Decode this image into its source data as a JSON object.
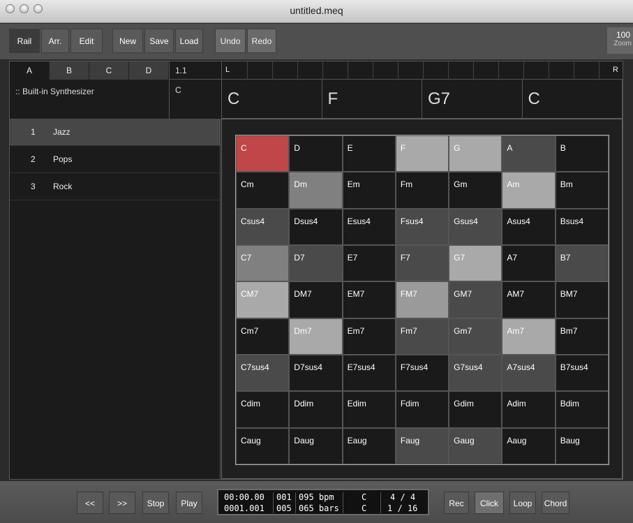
{
  "window": {
    "title": "untitled.meq"
  },
  "toolbar": {
    "rail": "Rail",
    "arr": "Arr.",
    "edit": "Edit",
    "new": "New",
    "save": "Save",
    "load": "Load",
    "undo": "Undo",
    "redo": "Redo",
    "zoom_value": "100",
    "zoom_label": "Zoom"
  },
  "tabs": [
    "A",
    "B",
    "C",
    "D"
  ],
  "synth": ":: Built-in Synthesizer",
  "position": {
    "pos": "1.1",
    "chord": "C"
  },
  "ruler": {
    "left": "L",
    "right": "R"
  },
  "timeline_chords": [
    "C",
    "F",
    "G7",
    "C"
  ],
  "styles": [
    {
      "num": "1",
      "name": "Jazz"
    },
    {
      "num": "2",
      "name": "Pops"
    },
    {
      "num": "3",
      "name": "Rock"
    }
  ],
  "grid": [
    [
      "C",
      "D",
      "E",
      "F",
      "G",
      "A",
      "B"
    ],
    [
      "Cm",
      "Dm",
      "Em",
      "Fm",
      "Gm",
      "Am",
      "Bm"
    ],
    [
      "Csus4",
      "Dsus4",
      "Esus4",
      "Fsus4",
      "Gsus4",
      "Asus4",
      "Bsus4"
    ],
    [
      "C7",
      "D7",
      "E7",
      "F7",
      "G7",
      "A7",
      "B7"
    ],
    [
      "CM7",
      "DM7",
      "EM7",
      "FM7",
      "GM7",
      "AM7",
      "BM7"
    ],
    [
      "Cm7",
      "Dm7",
      "Em7",
      "Fm7",
      "Gm7",
      "Am7",
      "Bm7"
    ],
    [
      "C7sus4",
      "D7sus4",
      "E7sus4",
      "F7sus4",
      "G7sus4",
      "A7sus4",
      "B7sus4"
    ],
    [
      "Cdim",
      "Ddim",
      "Edim",
      "Fdim",
      "Gdim",
      "Adim",
      "Bdim"
    ],
    [
      "Caug",
      "Daug",
      "Eaug",
      "Faug",
      "Gaug",
      "Aaug",
      "Baug"
    ]
  ],
  "transport": {
    "rew": "<<",
    "fwd": ">>",
    "stop": "Stop",
    "play": "Play",
    "rec": "Rec",
    "click": "Click",
    "loop": "Loop",
    "chord": "Chord",
    "time": "00:00.00",
    "bar_pos": "0001.001",
    "n1": "001",
    "n2": "005",
    "bpm": "095 bpm",
    "bars": "065 bars",
    "key1": "C",
    "key2": "C",
    "sig": "4 / 4",
    "quant": "1 / 16"
  }
}
